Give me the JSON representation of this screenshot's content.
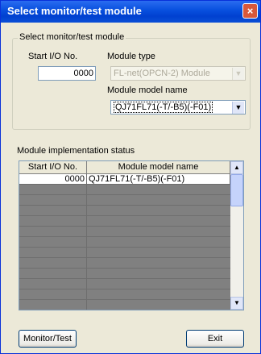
{
  "window": {
    "title": "Select monitor/test module",
    "close_glyph": "×"
  },
  "module_group": {
    "legend": "Select monitor/test module",
    "start_io_label": "Start I/O No.",
    "start_io_value": "0000",
    "module_type_label": "Module type",
    "module_type_value": "FL-net(OPCN-2) Module",
    "module_model_label": "Module model name",
    "module_model_value": "QJ71FL71(-T/-B5)(-F01)"
  },
  "status": {
    "label": "Module implementation status",
    "columns": [
      "Start I/O No.",
      "Module model name"
    ],
    "rows": [
      {
        "start_io": "0000",
        "model": "QJ71FL71(-T/-B5)(-F01)"
      }
    ]
  },
  "buttons": {
    "monitor_test": "Monitor/Test",
    "exit": "Exit"
  },
  "colors": {
    "title_bar": "#0a52e0",
    "dialog_bg": "#ece9d8",
    "grid_bg": "#808080"
  },
  "icons": {
    "scroll_up": "scroll-up-arrow",
    "scroll_down": "scroll-down-arrow",
    "dropdown": "dropdown-arrow",
    "close": "close-icon"
  }
}
